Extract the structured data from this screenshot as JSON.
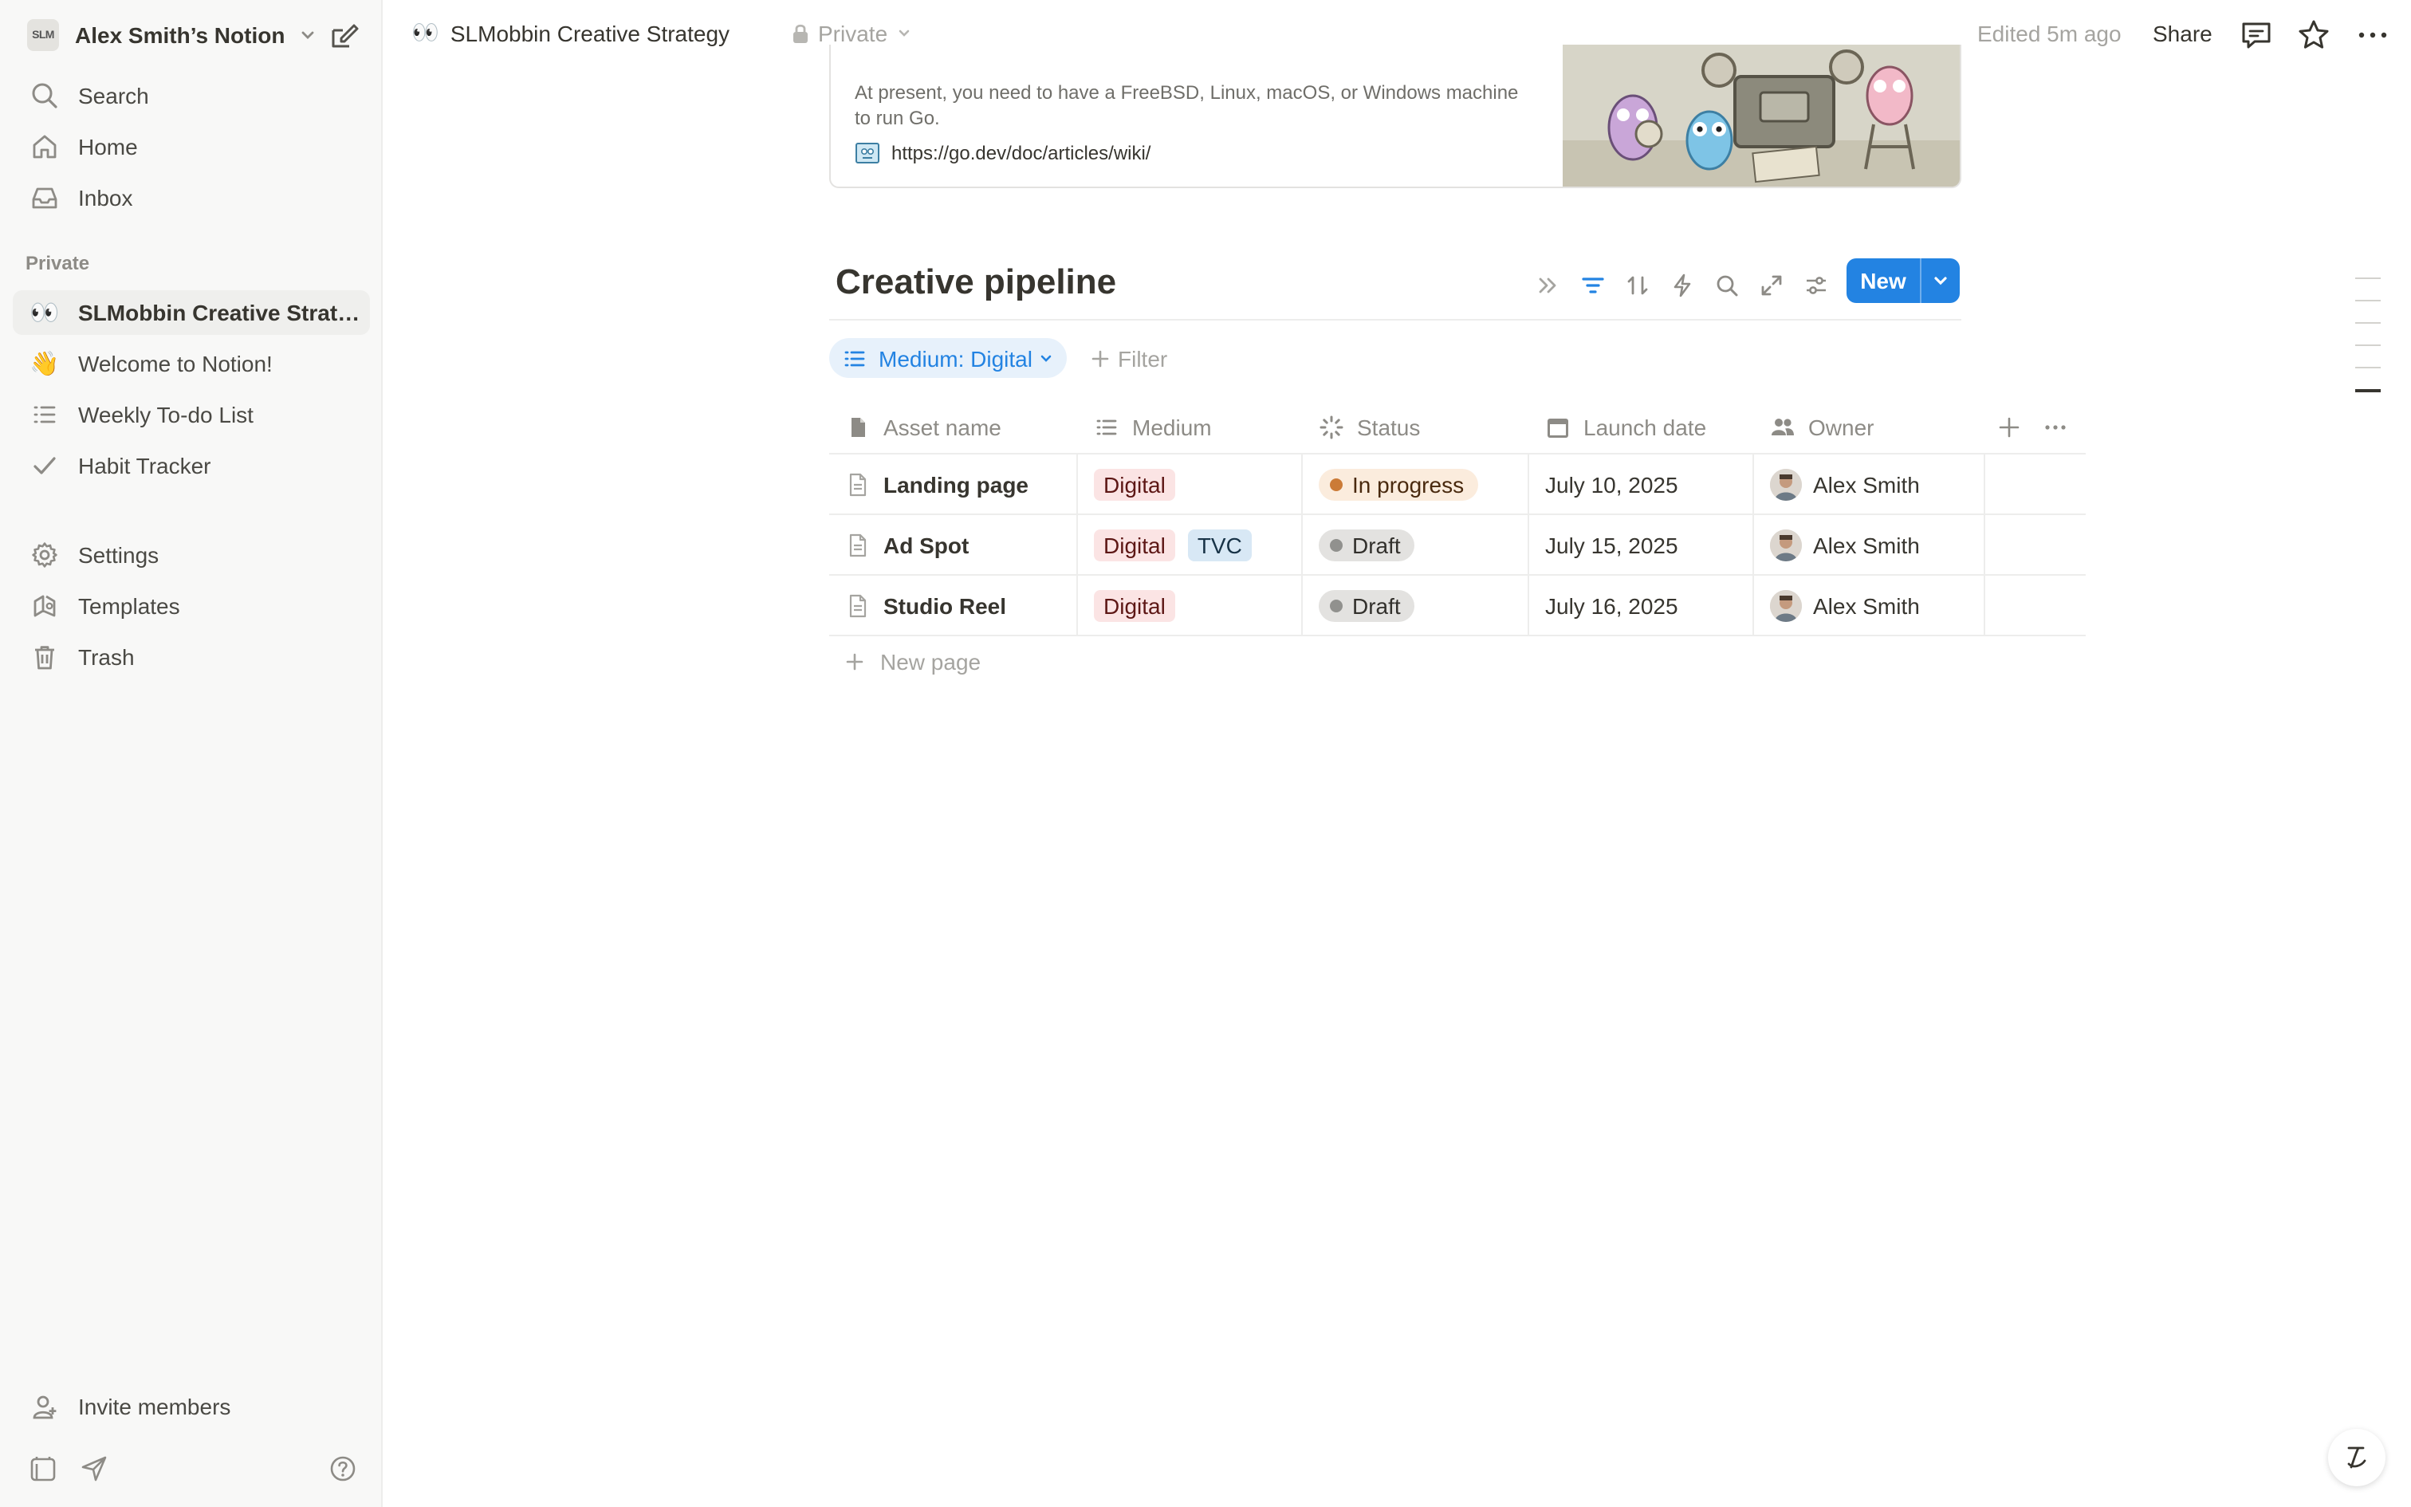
{
  "workspace": {
    "logo_text": "SLM",
    "name": "Alex Smith’s Notion"
  },
  "sidebar": {
    "nav": [
      {
        "icon": "search-icon",
        "label": "Search"
      },
      {
        "icon": "home-icon",
        "label": "Home"
      },
      {
        "icon": "inbox-icon",
        "label": "Inbox"
      }
    ],
    "section_label": "Private",
    "pages": [
      {
        "icon": "👀",
        "label": "SLMobbin Creative Strategy",
        "active": true
      },
      {
        "icon": "👋",
        "label": "Welcome to Notion!"
      },
      {
        "icon": "list-icon",
        "label": "Weekly To-do List"
      },
      {
        "icon": "check-icon",
        "label": "Habit Tracker"
      }
    ],
    "utility": [
      {
        "icon": "gear-icon",
        "label": "Settings"
      },
      {
        "icon": "templates-icon",
        "label": "Templates"
      },
      {
        "icon": "trash-icon",
        "label": "Trash"
      }
    ],
    "invite_label": "Invite members"
  },
  "topbar": {
    "page_icon": "👀",
    "page_title": "SLMobbin Creative Strategy",
    "privacy": "Private",
    "edited": "Edited 5m ago",
    "share": "Share"
  },
  "bookmark": {
    "description": "At present, you need to have a FreeBSD, Linux, macOS, or Windows machine to run Go.",
    "url": "https://go.dev/doc/articles/wiki/"
  },
  "database": {
    "title": "Creative pipeline",
    "new_button": "New",
    "filter_chip": "Medium: Digital",
    "add_filter": "Filter",
    "columns": [
      "Asset name",
      "Medium",
      "Status",
      "Launch date",
      "Owner"
    ],
    "rows": [
      {
        "name": "Landing page",
        "medium": [
          "Digital"
        ],
        "status": "In progress",
        "status_kind": "inprog",
        "launch": "July 10, 2025",
        "owner": "Alex Smith"
      },
      {
        "name": "Ad Spot",
        "medium": [
          "Digital",
          "TVC"
        ],
        "status": "Draft",
        "status_kind": "draft",
        "launch": "July 15, 2025",
        "owner": "Alex Smith"
      },
      {
        "name": "Studio Reel",
        "medium": [
          "Digital"
        ],
        "status": "Draft",
        "status_kind": "draft",
        "launch": "July 16, 2025",
        "owner": "Alex Smith"
      }
    ],
    "new_page": "New page"
  },
  "colors": {
    "accent": "#2383e2",
    "digital_tag": "#fbe4e4",
    "tvc_tag": "#d8e8f5",
    "in_progress": "#fbecdd",
    "draft": "#e3e2e0"
  }
}
